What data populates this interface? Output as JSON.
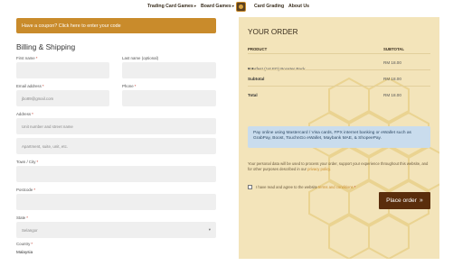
{
  "nav": {
    "items": [
      "Trading Card Games",
      "Board Games",
      "Card Grading",
      "About Us"
    ]
  },
  "coupon": {
    "text": "Have a coupon? Click here to enter your code"
  },
  "billing": {
    "title": "Billing & Shipping",
    "first_name_label": "First name",
    "last_name_label": "Last name (optional)",
    "email_label": "Email address",
    "email_value": "jbo89@gmail.com",
    "phone_label": "Phone",
    "address_label": "Address",
    "address1_placeholder": "Unit number and street name",
    "address2_placeholder": "Apartment, suite, unit, etc.",
    "city_label": "Town / City",
    "postcode_label": "Postcode",
    "state_label": "State",
    "state_value": "Selangor",
    "country_label": "Country",
    "country_value": "Malaysia",
    "required_mark": "*"
  },
  "order": {
    "title": "YOUR ORDER",
    "col_product": "PRODUCT",
    "col_subtotal": "SUBTOTAL",
    "item_name": "Everfest (1st ED) Booster Pack",
    "item_qty": "× 1",
    "item_price": "RM 18.00",
    "subtotal_label": "Subtotal",
    "subtotal_value": "RM 18.00",
    "total_label": "Total",
    "total_value": "RM 18.00",
    "payment_note": "Pay online using Mastercard / Visa cards, FPX internet banking or eWallet such as GrabPay, Boost, TouchnGo eWallet, Maybank MAE, & ShopeePay.",
    "privacy_text": "Your personal data will be used to process your order, support your experience throughout this website, and for other purposes described in our",
    "privacy_link": "privacy policy.",
    "terms_text": "I have read and agree to the website",
    "terms_link": "terms and conditions",
    "terms_req": "*",
    "place_order": "Place order",
    "place_order_arrow": "»"
  },
  "colors": {
    "accent": "#c98b2b",
    "panel": "#f3e4ba",
    "button": "#5a2d0c",
    "note_bg": "#c9dced"
  }
}
